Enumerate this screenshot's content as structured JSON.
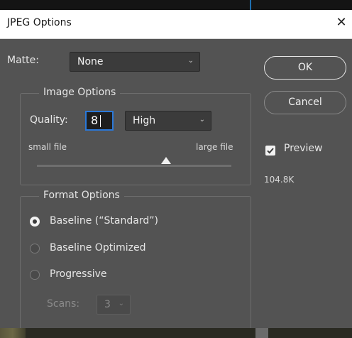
{
  "dialog": {
    "title": "JPEG Options",
    "close_glyph": "✕"
  },
  "matte": {
    "label": "Matte:",
    "value": "None"
  },
  "image_options": {
    "legend": "Image Options",
    "quality_label": "Quality:",
    "quality_value": "8",
    "quality_level": "High",
    "small_file_label": "small file",
    "large_file_label": "large file",
    "slider_value": 8,
    "slider_max": 12
  },
  "format_options": {
    "legend": "Format Options",
    "options": [
      {
        "label": "Baseline (“Standard”)",
        "selected": true,
        "enabled": true
      },
      {
        "label": "Baseline Optimized",
        "selected": false,
        "enabled": true
      },
      {
        "label": "Progressive",
        "selected": false,
        "enabled": true
      }
    ],
    "scans_label": "Scans:",
    "scans_value": "3"
  },
  "buttons": {
    "ok": "OK",
    "cancel": "Cancel"
  },
  "preview": {
    "label": "Preview",
    "checked": true,
    "file_size": "104.8K"
  },
  "icons": {
    "close": "close-icon",
    "chevron": "chevron-down-icon",
    "check": "checkmark-icon"
  },
  "colors": {
    "panel": "#535353",
    "focus": "#2b78d8",
    "text": "#e6e6e6"
  }
}
